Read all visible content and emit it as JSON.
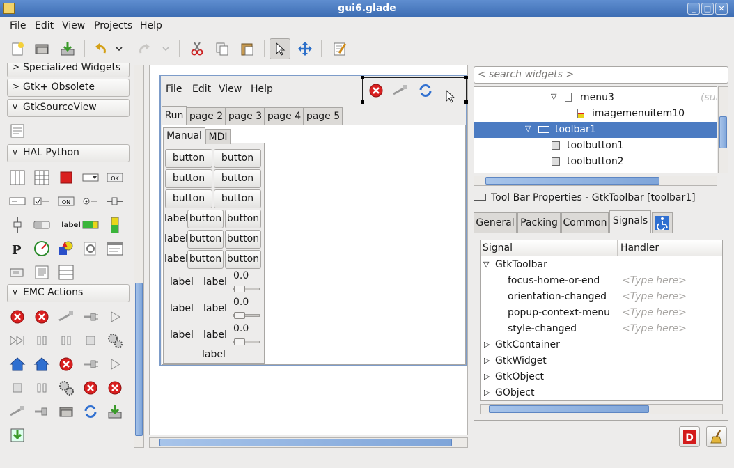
{
  "window": {
    "title": "gui6.glade"
  },
  "menubar": {
    "items": [
      "File",
      "Edit",
      "View",
      "Projects",
      "Help"
    ]
  },
  "toolbar": {
    "icons": [
      "new-icon",
      "open-icon",
      "save-icon",
      "undo-icon",
      "undo-dropdown-icon",
      "redo-icon",
      "redo-dropdown-icon",
      "cut-icon",
      "copy-icon",
      "paste-icon",
      "pointer-icon",
      "drag-resize-icon",
      "edit-icon"
    ]
  },
  "palette": {
    "groups": {
      "specialized": "Specialized Widgets",
      "obsolete": "Gtk+ Obsolete",
      "sourceview": "GtkSourceView",
      "hal": "HAL Python",
      "emc": "EMC Actions"
    },
    "hal_label_icon": "label",
    "hal_ok_icon": "OK",
    "hal_on_icon": "ON"
  },
  "design": {
    "menu": [
      "File",
      "Edit",
      "View",
      "Help"
    ],
    "tabs": [
      "Run",
      "page 2",
      "page 3",
      "page 4",
      "page 5"
    ],
    "inner_tabs": [
      "Manual",
      "MDI"
    ],
    "button": "button",
    "label": "label",
    "scale_value": "0.0"
  },
  "search": {
    "placeholder": "< search widgets >"
  },
  "tree": {
    "rows": [
      "menu3",
      "imagemenuitem10",
      "toolbar1",
      "toolbutton1",
      "toolbutton2"
    ],
    "sub_hint": "(sub"
  },
  "properties": {
    "title": "Tool Bar Properties - GtkToolbar [toolbar1]",
    "tabs": [
      "General",
      "Packing",
      "Common",
      "Signals"
    ],
    "columns": {
      "signal": "Signal",
      "handler": "Handler"
    },
    "gtktoolbar": "GtkToolbar",
    "signals": [
      "focus-home-or-end",
      "orientation-changed",
      "popup-context-menu",
      "style-changed"
    ],
    "handler_hint": "<Type here>",
    "classes": [
      "GtkContainer",
      "GtkWidget",
      "GtkObject",
      "GObject"
    ]
  },
  "colors": {
    "selection": "#4b7bc2",
    "titlebar": "#3d6db3",
    "scroll_thumb": "#7fa5d9"
  }
}
